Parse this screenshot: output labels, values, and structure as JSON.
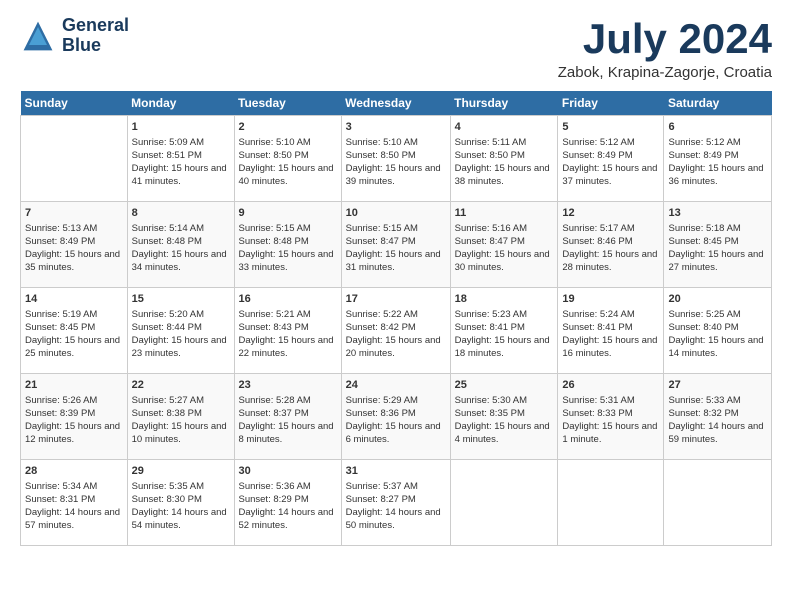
{
  "logo": {
    "line1": "General",
    "line2": "Blue"
  },
  "title": "July 2024",
  "location": "Zabok, Krapina-Zagorje, Croatia",
  "days_of_week": [
    "Sunday",
    "Monday",
    "Tuesday",
    "Wednesday",
    "Thursday",
    "Friday",
    "Saturday"
  ],
  "weeks": [
    [
      {
        "day": "",
        "info": ""
      },
      {
        "day": "1",
        "sunrise": "Sunrise: 5:09 AM",
        "sunset": "Sunset: 8:51 PM",
        "daylight": "Daylight: 15 hours and 41 minutes."
      },
      {
        "day": "2",
        "sunrise": "Sunrise: 5:10 AM",
        "sunset": "Sunset: 8:50 PM",
        "daylight": "Daylight: 15 hours and 40 minutes."
      },
      {
        "day": "3",
        "sunrise": "Sunrise: 5:10 AM",
        "sunset": "Sunset: 8:50 PM",
        "daylight": "Daylight: 15 hours and 39 minutes."
      },
      {
        "day": "4",
        "sunrise": "Sunrise: 5:11 AM",
        "sunset": "Sunset: 8:50 PM",
        "daylight": "Daylight: 15 hours and 38 minutes."
      },
      {
        "day": "5",
        "sunrise": "Sunrise: 5:12 AM",
        "sunset": "Sunset: 8:49 PM",
        "daylight": "Daylight: 15 hours and 37 minutes."
      },
      {
        "day": "6",
        "sunrise": "Sunrise: 5:12 AM",
        "sunset": "Sunset: 8:49 PM",
        "daylight": "Daylight: 15 hours and 36 minutes."
      }
    ],
    [
      {
        "day": "7",
        "sunrise": "Sunrise: 5:13 AM",
        "sunset": "Sunset: 8:49 PM",
        "daylight": "Daylight: 15 hours and 35 minutes."
      },
      {
        "day": "8",
        "sunrise": "Sunrise: 5:14 AM",
        "sunset": "Sunset: 8:48 PM",
        "daylight": "Daylight: 15 hours and 34 minutes."
      },
      {
        "day": "9",
        "sunrise": "Sunrise: 5:15 AM",
        "sunset": "Sunset: 8:48 PM",
        "daylight": "Daylight: 15 hours and 33 minutes."
      },
      {
        "day": "10",
        "sunrise": "Sunrise: 5:15 AM",
        "sunset": "Sunset: 8:47 PM",
        "daylight": "Daylight: 15 hours and 31 minutes."
      },
      {
        "day": "11",
        "sunrise": "Sunrise: 5:16 AM",
        "sunset": "Sunset: 8:47 PM",
        "daylight": "Daylight: 15 hours and 30 minutes."
      },
      {
        "day": "12",
        "sunrise": "Sunrise: 5:17 AM",
        "sunset": "Sunset: 8:46 PM",
        "daylight": "Daylight: 15 hours and 28 minutes."
      },
      {
        "day": "13",
        "sunrise": "Sunrise: 5:18 AM",
        "sunset": "Sunset: 8:45 PM",
        "daylight": "Daylight: 15 hours and 27 minutes."
      }
    ],
    [
      {
        "day": "14",
        "sunrise": "Sunrise: 5:19 AM",
        "sunset": "Sunset: 8:45 PM",
        "daylight": "Daylight: 15 hours and 25 minutes."
      },
      {
        "day": "15",
        "sunrise": "Sunrise: 5:20 AM",
        "sunset": "Sunset: 8:44 PM",
        "daylight": "Daylight: 15 hours and 23 minutes."
      },
      {
        "day": "16",
        "sunrise": "Sunrise: 5:21 AM",
        "sunset": "Sunset: 8:43 PM",
        "daylight": "Daylight: 15 hours and 22 minutes."
      },
      {
        "day": "17",
        "sunrise": "Sunrise: 5:22 AM",
        "sunset": "Sunset: 8:42 PM",
        "daylight": "Daylight: 15 hours and 20 minutes."
      },
      {
        "day": "18",
        "sunrise": "Sunrise: 5:23 AM",
        "sunset": "Sunset: 8:41 PM",
        "daylight": "Daylight: 15 hours and 18 minutes."
      },
      {
        "day": "19",
        "sunrise": "Sunrise: 5:24 AM",
        "sunset": "Sunset: 8:41 PM",
        "daylight": "Daylight: 15 hours and 16 minutes."
      },
      {
        "day": "20",
        "sunrise": "Sunrise: 5:25 AM",
        "sunset": "Sunset: 8:40 PM",
        "daylight": "Daylight: 15 hours and 14 minutes."
      }
    ],
    [
      {
        "day": "21",
        "sunrise": "Sunrise: 5:26 AM",
        "sunset": "Sunset: 8:39 PM",
        "daylight": "Daylight: 15 hours and 12 minutes."
      },
      {
        "day": "22",
        "sunrise": "Sunrise: 5:27 AM",
        "sunset": "Sunset: 8:38 PM",
        "daylight": "Daylight: 15 hours and 10 minutes."
      },
      {
        "day": "23",
        "sunrise": "Sunrise: 5:28 AM",
        "sunset": "Sunset: 8:37 PM",
        "daylight": "Daylight: 15 hours and 8 minutes."
      },
      {
        "day": "24",
        "sunrise": "Sunrise: 5:29 AM",
        "sunset": "Sunset: 8:36 PM",
        "daylight": "Daylight: 15 hours and 6 minutes."
      },
      {
        "day": "25",
        "sunrise": "Sunrise: 5:30 AM",
        "sunset": "Sunset: 8:35 PM",
        "daylight": "Daylight: 15 hours and 4 minutes."
      },
      {
        "day": "26",
        "sunrise": "Sunrise: 5:31 AM",
        "sunset": "Sunset: 8:33 PM",
        "daylight": "Daylight: 15 hours and 1 minute."
      },
      {
        "day": "27",
        "sunrise": "Sunrise: 5:33 AM",
        "sunset": "Sunset: 8:32 PM",
        "daylight": "Daylight: 14 hours and 59 minutes."
      }
    ],
    [
      {
        "day": "28",
        "sunrise": "Sunrise: 5:34 AM",
        "sunset": "Sunset: 8:31 PM",
        "daylight": "Daylight: 14 hours and 57 minutes."
      },
      {
        "day": "29",
        "sunrise": "Sunrise: 5:35 AM",
        "sunset": "Sunset: 8:30 PM",
        "daylight": "Daylight: 14 hours and 54 minutes."
      },
      {
        "day": "30",
        "sunrise": "Sunrise: 5:36 AM",
        "sunset": "Sunset: 8:29 PM",
        "daylight": "Daylight: 14 hours and 52 minutes."
      },
      {
        "day": "31",
        "sunrise": "Sunrise: 5:37 AM",
        "sunset": "Sunset: 8:27 PM",
        "daylight": "Daylight: 14 hours and 50 minutes."
      },
      {
        "day": "",
        "info": ""
      },
      {
        "day": "",
        "info": ""
      },
      {
        "day": "",
        "info": ""
      }
    ]
  ]
}
